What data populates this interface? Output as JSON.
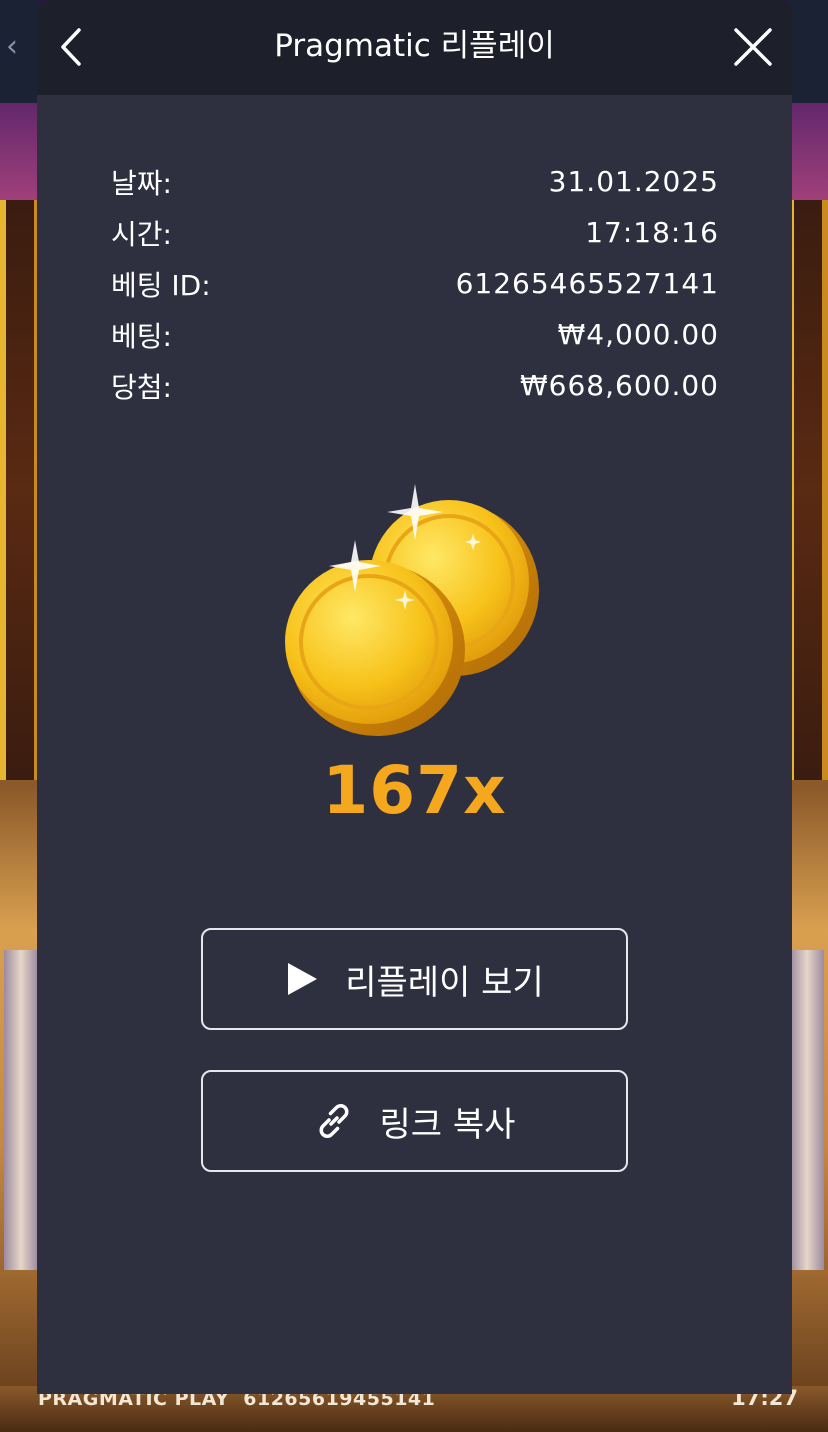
{
  "modal": {
    "title": "Pragmatic 리플레이",
    "back_icon": "chevron-left-icon",
    "close_icon": "close-icon"
  },
  "details": [
    {
      "label": "날짜:",
      "value": "31.01.2025"
    },
    {
      "label": "시간:",
      "value": "17:18:16"
    },
    {
      "label": "베팅 ID:",
      "value": "61265465527141"
    },
    {
      "label": "베팅:",
      "value": "₩4,000.00"
    },
    {
      "label": "당첨:",
      "value": "₩668,600.00"
    }
  ],
  "result": {
    "multiplier": "167x",
    "coin_icon": "gold-coins-icon"
  },
  "buttons": {
    "replay_label": "리플레이 보기",
    "replay_icon": "play-icon",
    "copy_label": "링크 복사",
    "copy_icon": "link-icon"
  },
  "footer": {
    "brand": "PRAGMATIC PLAY",
    "round_id": "61265619455141",
    "time": "17:27"
  },
  "colors": {
    "modal_bg": "#2e3040",
    "header_bg": "#1d1f2b",
    "multiplier": "#f5a81e",
    "text": "#ffffff"
  }
}
